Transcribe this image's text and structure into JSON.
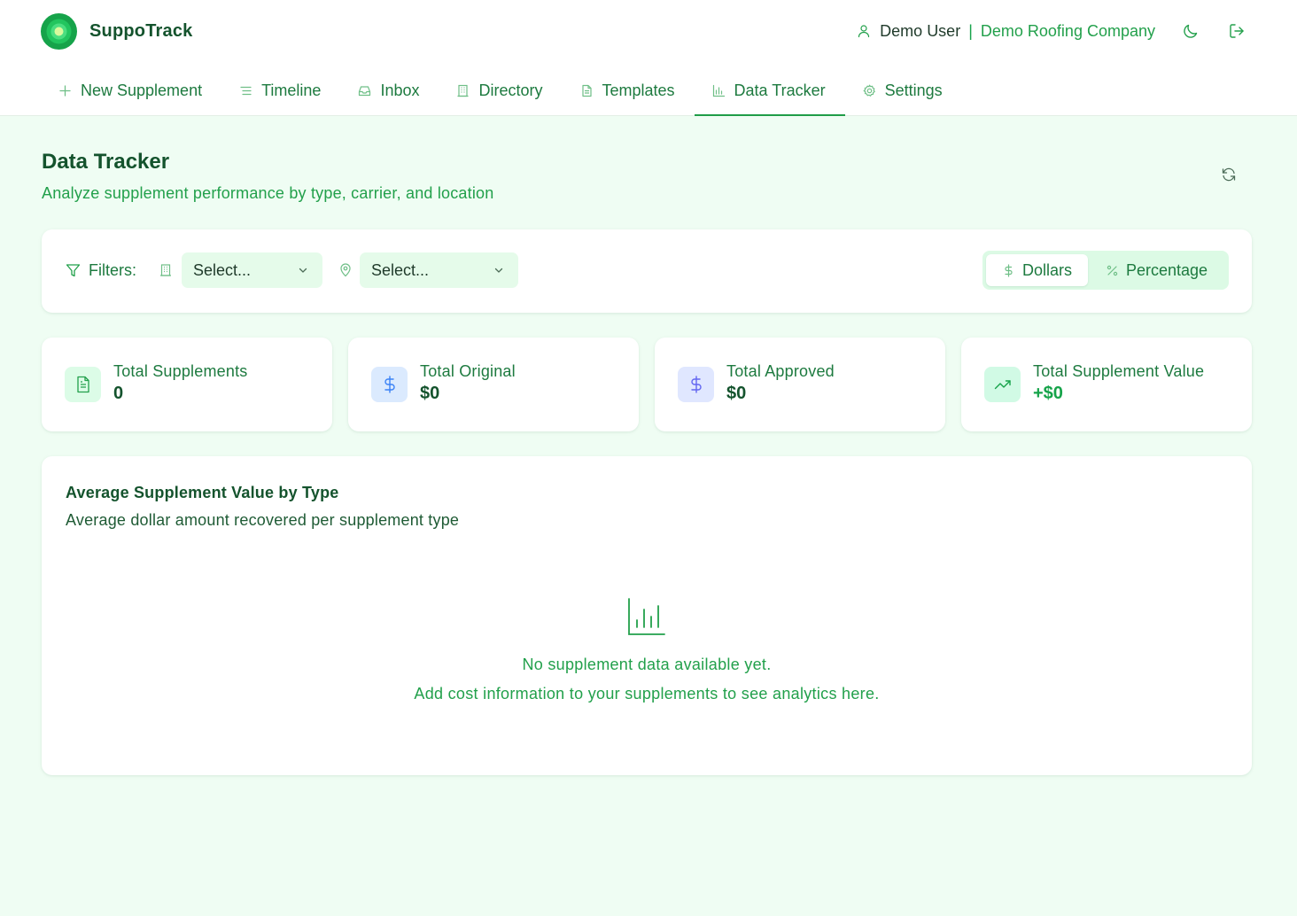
{
  "app": {
    "name": "SuppoTrack"
  },
  "user": {
    "name": "Demo User",
    "separator": "|",
    "company": "Demo Roofing Company"
  },
  "nav": {
    "items": [
      {
        "label": "New Supplement",
        "icon": "plus-icon"
      },
      {
        "label": "Timeline",
        "icon": "list-icon"
      },
      {
        "label": "Inbox",
        "icon": "inbox-icon"
      },
      {
        "label": "Directory",
        "icon": "building-icon"
      },
      {
        "label": "Templates",
        "icon": "file-text-icon"
      },
      {
        "label": "Data Tracker",
        "icon": "bar-chart-icon",
        "active": true
      },
      {
        "label": "Settings",
        "icon": "gear-icon"
      }
    ]
  },
  "page": {
    "title": "Data Tracker",
    "subtitle": "Analyze supplement performance by type, carrier, and location"
  },
  "filters": {
    "label": "Filters:",
    "carrier_select": {
      "value": "Select...",
      "icon": "building-icon"
    },
    "location_select": {
      "value": "Select...",
      "icon": "map-pin-icon"
    },
    "view_toggle": {
      "options": [
        {
          "label": "Dollars",
          "icon": "dollar-icon",
          "active": true
        },
        {
          "label": "Percentage",
          "icon": "percent-icon",
          "active": false
        }
      ]
    }
  },
  "stats": [
    {
      "label": "Total Supplements",
      "value": "0",
      "icon": "file-text-icon",
      "icon_bg": "#dcfce7",
      "icon_color": "#22a04b"
    },
    {
      "label": "Total Original",
      "value": "$0",
      "icon": "dollar-icon",
      "icon_bg": "#dbeafe",
      "icon_color": "#3b82f6"
    },
    {
      "label": "Total Approved",
      "value": "$0",
      "icon": "dollar-icon",
      "icon_bg": "#e0e7ff",
      "icon_color": "#6366f1"
    },
    {
      "label": "Total Supplement Value",
      "value": "+$0",
      "icon": "trending-up-icon",
      "icon_bg": "#d1fae5",
      "icon_color": "#16a34a"
    }
  ],
  "chart": {
    "title": "Average Supplement Value by Type",
    "subtitle": "Average dollar amount recovered per supplement type",
    "empty_line1": "No supplement data available yet.",
    "empty_line2": "Add cost information to your supplements to see analytics here."
  },
  "colors": {
    "accent": "#1f9d48",
    "background": "#effdf3",
    "text_dark": "#14532d",
    "text_green": "#22a04b"
  }
}
